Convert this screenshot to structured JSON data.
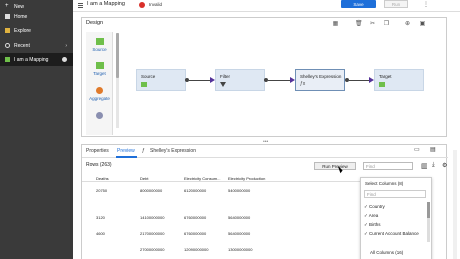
{
  "nav": {
    "items": [
      {
        "label": "New"
      },
      {
        "label": "Home"
      },
      {
        "label": "Explore"
      },
      {
        "label": "Recent"
      },
      {
        "label": "I am a Mapping"
      }
    ]
  },
  "header": {
    "title": "I am a Mapping",
    "status": "Invalid",
    "save_label": "Save",
    "run_label": "Run"
  },
  "design": {
    "title": "Design",
    "palette": [
      {
        "label": "Source"
      },
      {
        "label": "Target"
      },
      {
        "label": "Aggregate"
      }
    ],
    "nodes": [
      {
        "label": "Source"
      },
      {
        "label": "Filter"
      },
      {
        "label": "Shelley's Expression"
      },
      {
        "label": "Target"
      }
    ]
  },
  "bottom": {
    "tabs": [
      {
        "label": "Properties"
      },
      {
        "label": "Preview"
      },
      {
        "label": "Shelley's Expression"
      }
    ],
    "rows_label": "Rows (263)",
    "run_preview_label": "Run Preview",
    "find_placeholder": "Find",
    "table": {
      "columns": [
        "Deaths",
        "Debt",
        "Electricity Consum...",
        "Electricity Production"
      ],
      "rows": [
        [
          "20750",
          "8000000000",
          "6120000000",
          "5400000000"
        ],
        [
          "3120",
          "14100000000",
          "6760000000",
          "5640000000"
        ],
        [
          "4600",
          "21700000000",
          "6760000000",
          "5640000000"
        ],
        [
          "",
          "27000000000",
          "12090000000",
          "13000000000"
        ]
      ]
    },
    "column_selector": {
      "title": "Select Columns (8)",
      "find_placeholder": "Find",
      "options": [
        {
          "label": "Country"
        },
        {
          "label": "Area"
        },
        {
          "label": "Births"
        },
        {
          "label": "Current Account Balance"
        }
      ],
      "all_label": "All Columns (16)"
    }
  }
}
